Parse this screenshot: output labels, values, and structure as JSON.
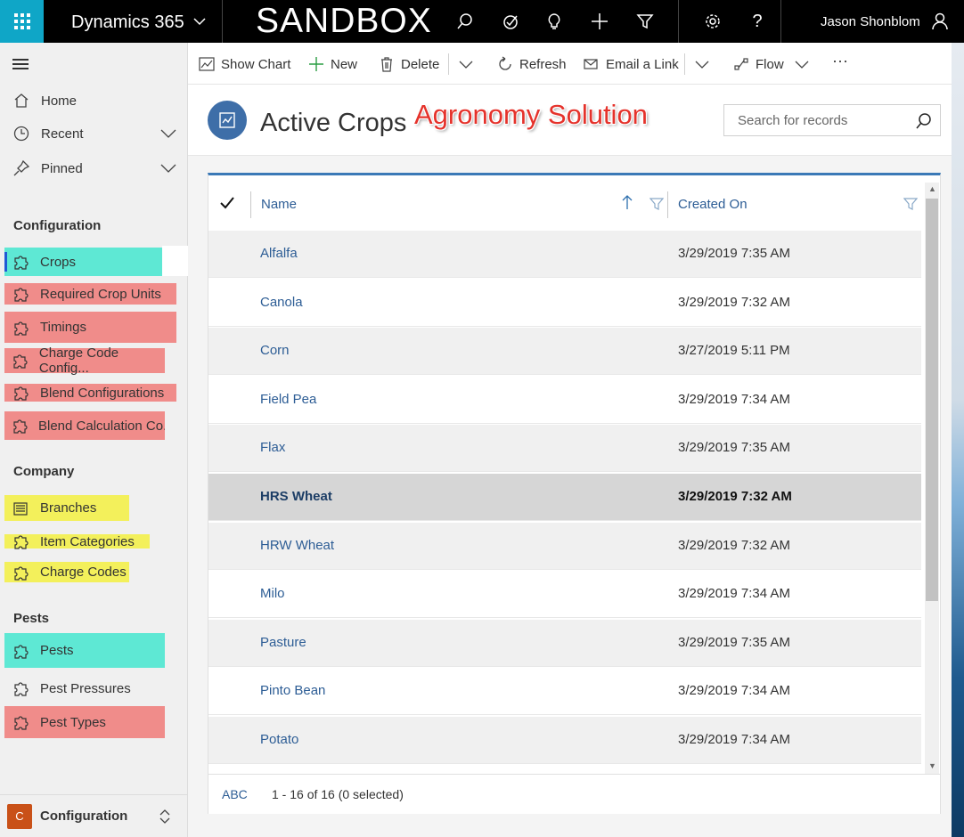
{
  "topbar": {
    "app_name": "Dynamics 365",
    "environment": "SANDBOX",
    "user_name": "Jason Shonblom",
    "accent": "#0fa6c7"
  },
  "sidebar": {
    "nav": [
      {
        "label": "Home",
        "icon": "home-icon"
      },
      {
        "label": "Recent",
        "icon": "clock-icon"
      },
      {
        "label": "Pinned",
        "icon": "pin-icon"
      }
    ],
    "sections": [
      {
        "title": "Configuration",
        "items": [
          {
            "label": "Crops",
            "highlight": "#5ee8d4",
            "active": true
          },
          {
            "label": "Required Crop Units",
            "highlight": "#f08c8a"
          },
          {
            "label": "Timings",
            "highlight": "#f08c8a"
          },
          {
            "label": "Charge Code Config...",
            "highlight": "#f08c8a"
          },
          {
            "label": "Blend Configurations",
            "highlight": "#f08c8a"
          },
          {
            "label": "Blend Calculation Co...",
            "highlight": "#f08c8a"
          }
        ]
      },
      {
        "title": "Company",
        "items": [
          {
            "label": "Branches",
            "highlight": "#f3f05b"
          },
          {
            "label": "Item Categories",
            "highlight": "#f3f05b"
          },
          {
            "label": "Charge Codes",
            "highlight": "#f3f05b"
          }
        ]
      },
      {
        "title": "Pests",
        "items": [
          {
            "label": "Pests",
            "highlight": "#5ee8d4"
          },
          {
            "label": "Pest Pressures",
            "highlight": ""
          },
          {
            "label": "Pest Types",
            "highlight": "#f08c8a"
          }
        ]
      }
    ],
    "area_badge": "C",
    "area_name": "Configuration"
  },
  "commandbar": {
    "show_chart": "Show Chart",
    "new": "New",
    "delete": "Delete",
    "refresh": "Refresh",
    "email_link": "Email a Link",
    "flow": "Flow",
    "more": "···"
  },
  "header": {
    "title": "Active Crops",
    "overlay_label": "Agronomy Solution",
    "search_placeholder": "Search for records"
  },
  "grid": {
    "columns": [
      "Name",
      "Created On"
    ],
    "rows": [
      {
        "name": "Alfalfa",
        "created": "3/29/2019 7:35 AM"
      },
      {
        "name": "Canola",
        "created": "3/29/2019 7:32 AM"
      },
      {
        "name": "Corn",
        "created": "3/27/2019 5:11 PM"
      },
      {
        "name": "Field Pea",
        "created": "3/29/2019 7:34 AM"
      },
      {
        "name": "Flax",
        "created": "3/29/2019 7:35 AM"
      },
      {
        "name": "HRS Wheat",
        "created": "3/29/2019 7:32 AM",
        "selected": true
      },
      {
        "name": "HRW Wheat",
        "created": "3/29/2019 7:32 AM"
      },
      {
        "name": "Milo",
        "created": "3/29/2019 7:34 AM"
      },
      {
        "name": "Pasture",
        "created": "3/29/2019 7:35 AM"
      },
      {
        "name": "Pinto Bean",
        "created": "3/29/2019 7:34 AM"
      },
      {
        "name": "Potato",
        "created": "3/29/2019 7:34 AM"
      }
    ],
    "footer_abc": "ABC",
    "footer_count": "1 - 16 of 16 (0 selected)"
  }
}
